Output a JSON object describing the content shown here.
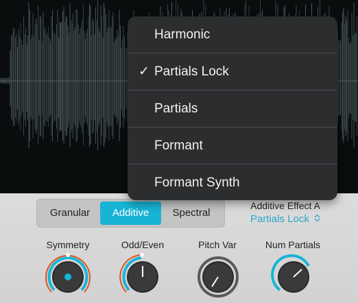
{
  "menu": {
    "items": [
      {
        "label": "Harmonic",
        "checked": ""
      },
      {
        "label": "Partials Lock",
        "checked": "✓"
      },
      {
        "label": "Partials",
        "checked": ""
      },
      {
        "label": "Formant",
        "checked": ""
      },
      {
        "label": "Formant Synth",
        "checked": ""
      }
    ]
  },
  "mode_selector": {
    "options": [
      "Granular",
      "Additive",
      "Spectral"
    ],
    "selected": "Additive"
  },
  "effect": {
    "label": "Additive Effect A",
    "value": "Partials Lock",
    "chevron": "⌃⌄"
  },
  "knobs": [
    {
      "label": "Symmetry",
      "icon": "symmetry-knob"
    },
    {
      "label": "Odd/Even",
      "icon": "odd-even-knob"
    },
    {
      "label": "Pitch Var",
      "icon": "pitch-var-knob"
    },
    {
      "label": "Num Partials",
      "icon": "num-partials-knob"
    }
  ],
  "colors": {
    "accent": "#17b4d6",
    "modulation": "#e0531f",
    "waveform": "#5d6b6e",
    "menu_bg": "#2b2d2f"
  }
}
